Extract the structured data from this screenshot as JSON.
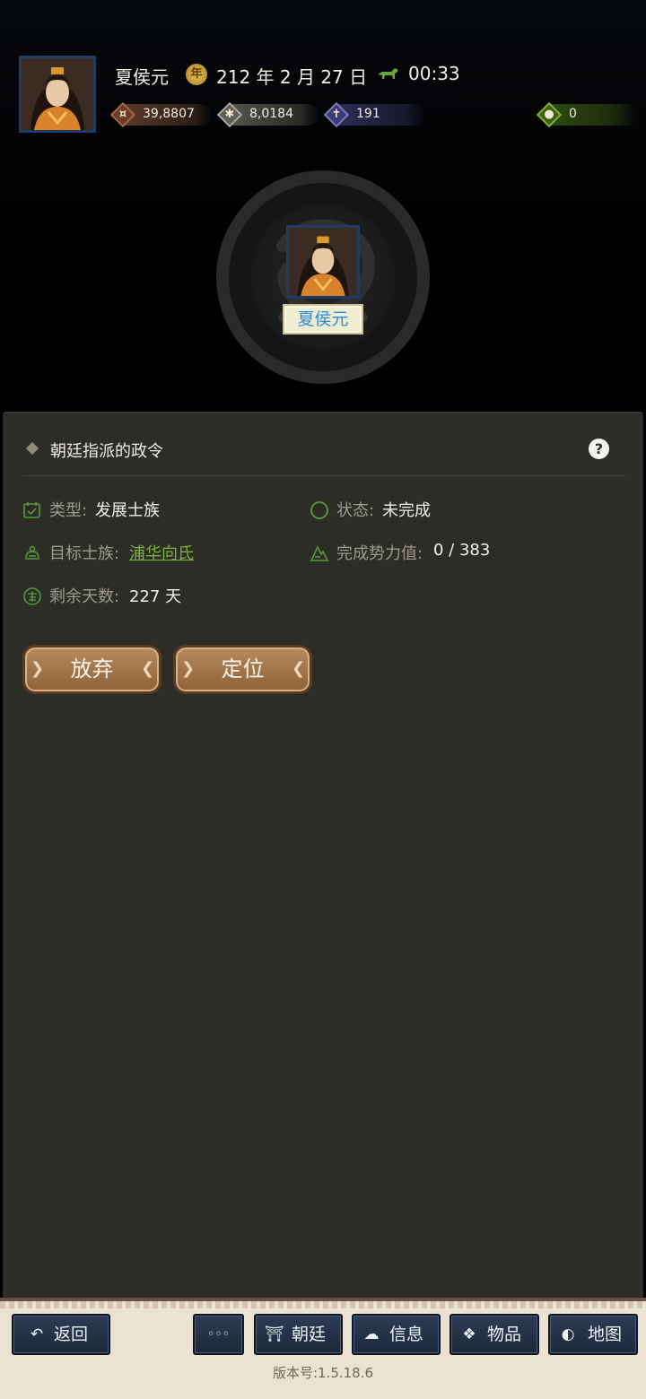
{
  "header": {
    "name": "夏侯元",
    "date": "212 年 2 月 27 日",
    "time": "00:33",
    "resources": [
      {
        "icon": "coins-icon",
        "value": "39,8807"
      },
      {
        "icon": "grain-icon",
        "value": "8,0184"
      },
      {
        "icon": "soldier-icon",
        "value": "191"
      },
      {
        "icon": "money-bag-icon",
        "value": "0"
      }
    ]
  },
  "center": {
    "name": "夏侯元"
  },
  "panel": {
    "title": "朝廷指派的政令",
    "help": "?",
    "type_label": "类型:",
    "type_value": "发展士族",
    "status_label": "状态:",
    "status_value": "未完成",
    "target_label": "目标士族:",
    "target_value": "浦华向氏",
    "progress_label": "完成势力值:",
    "progress_value": "0 / 383",
    "days_label": "剩余天数:",
    "days_value": "227 天",
    "buttons": {
      "abandon": "放弃",
      "locate": "定位"
    }
  },
  "bottom": {
    "back": "返回",
    "more": "◦◦◦",
    "court": "朝廷",
    "info": "信息",
    "items": "物品",
    "map": "地图",
    "version": "版本号:1.5.18.6"
  },
  "colors": {
    "panel_bg": "#2d2d28",
    "link_green": "#7db33a",
    "button_brown": "#a27349",
    "nav_blue": "#243149"
  }
}
